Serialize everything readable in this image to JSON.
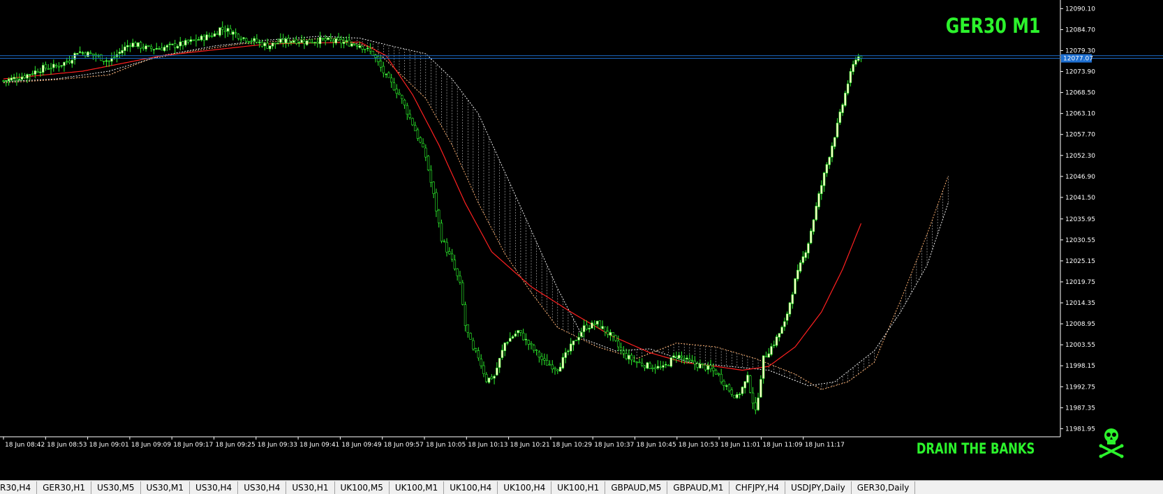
{
  "symbol_title": "GER30 M1",
  "brand_text": "DRAIN THE BANKS",
  "brand_icon": "skull-crossbones-icon",
  "colors": {
    "background": "#000000",
    "bull_candle": "#ffffc8",
    "bear_candle": "#000000",
    "wick": "#2cf32c",
    "moving_average": "#ff2020",
    "kumo_line_a": "#ffb070",
    "kumo_line_b": "#f0f0f0",
    "horizontal_line": "#1e6fd0",
    "price_box": "#1e6fd0",
    "title": "#2cf32c"
  },
  "price_box_value": "12077.07",
  "tabs": [
    "R30,H4",
    "GER30,H1",
    "US30,M5",
    "US30,M1",
    "US30,H4",
    "US30,H4",
    "US30,H1",
    "UK100,M5",
    "UK100,M1",
    "UK100,H4",
    "UK100,H4",
    "UK100,H1",
    "GBPAUD,M5",
    "GBPAUD,M1",
    "CHFJPY,H4",
    "USDJPY,Daily",
    "GER30,Daily"
  ],
  "chart_data": {
    "type": "candlestick",
    "title": "GER30 M1",
    "ylim": [
      11980.4,
      12091.6
    ],
    "y_ticks": [
      "12090.10",
      "12084.70",
      "12079.30",
      "12073.90",
      "12068.50",
      "12063.10",
      "12057.70",
      "12052.30",
      "12046.90",
      "12041.50",
      "12035.95",
      "12030.55",
      "12025.15",
      "12019.75",
      "12014.35",
      "12008.95",
      "12003.55",
      "11998.15",
      "11992.75",
      "11987.35",
      "11981.95"
    ],
    "x_ticks": [
      "18 Jun 08:42",
      "18 Jun 08:53",
      "18 Jun 09:01",
      "18 Jun 09:09",
      "18 Jun 09:17",
      "18 Jun 09:25",
      "18 Jun 09:33",
      "18 Jun 09:41",
      "18 Jun 09:49",
      "18 Jun 09:57",
      "18 Jun 10:05",
      "18 Jun 10:13",
      "18 Jun 10:21",
      "18 Jun 10:29",
      "18 Jun 10:37",
      "18 Jun 10:45",
      "18 Jun 10:53",
      "18 Jun 11:01",
      "18 Jun 11:09",
      "18 Jun 11:17"
    ],
    "horizontal_lines": [
      12078.0,
      12077.3
    ],
    "anchors": {
      "close": [
        [
          0,
          12071.5
        ],
        [
          8,
          12072.8
        ],
        [
          15,
          12074.8
        ],
        [
          20,
          12075.2
        ],
        [
          25,
          12076.8
        ],
        [
          28,
          12079.1
        ],
        [
          35,
          12078.0
        ],
        [
          40,
          12076.5
        ],
        [
          48,
          12081.2
        ],
        [
          55,
          12079.8
        ],
        [
          60,
          12080.0
        ],
        [
          68,
          12081.0
        ],
        [
          72,
          12081.8
        ],
        [
          80,
          12083.5
        ],
        [
          82,
          12085.0
        ],
        [
          86,
          12084.3
        ],
        [
          90,
          12082.8
        ],
        [
          95,
          12081.8
        ],
        [
          100,
          12080.5
        ],
        [
          105,
          12081.5
        ],
        [
          110,
          12082.0
        ],
        [
          115,
          12081.6
        ],
        [
          120,
          12082.0
        ],
        [
          125,
          12081.7
        ],
        [
          130,
          12081.3
        ],
        [
          135,
          12080.8
        ],
        [
          140,
          12078.5
        ],
        [
          145,
          12072.5
        ],
        [
          150,
          12068.0
        ],
        [
          155,
          12060.5
        ],
        [
          160,
          12052.0
        ],
        [
          163,
          12042.0
        ],
        [
          166,
          12031.0
        ],
        [
          170,
          12025.0
        ],
        [
          173,
          12019.0
        ],
        [
          175,
          12008.5
        ],
        [
          178,
          12002.0
        ],
        [
          180,
          12000.5
        ],
        [
          183,
          11994.5
        ],
        [
          186,
          11995.5
        ],
        [
          190,
          12004.0
        ],
        [
          195,
          12007.0
        ],
        [
          200,
          12003.0
        ],
        [
          205,
          11999.0
        ],
        [
          210,
          11997.5
        ],
        [
          215,
          12003.0
        ],
        [
          220,
          12008.0
        ],
        [
          225,
          12009.0
        ],
        [
          230,
          12006.0
        ],
        [
          235,
          12001.0
        ],
        [
          240,
          11999.0
        ],
        [
          245,
          11998.0
        ],
        [
          250,
          11997.5
        ],
        [
          255,
          12001.0
        ],
        [
          260,
          11999.0
        ],
        [
          265,
          11998.0
        ],
        [
          270,
          11996.5
        ],
        [
          275,
          11992.0
        ],
        [
          278,
          11990.0
        ],
        [
          282,
          11995.0
        ],
        [
          285,
          11986.0
        ],
        [
          288,
          12000.0
        ],
        [
          292,
          12004.0
        ],
        [
          296,
          12009.0
        ],
        [
          300,
          12020.0
        ],
        [
          305,
          12030.0
        ],
        [
          309,
          12042.0
        ],
        [
          312,
          12050.0
        ],
        [
          316,
          12060.0
        ],
        [
          320,
          12071.0
        ],
        [
          323,
          12077.5
        ],
        [
          325,
          12077.8
        ]
      ],
      "ma": [
        [
          0,
          12072.0
        ],
        [
          30,
          12074.0
        ],
        [
          60,
          12078.0
        ],
        [
          100,
          12081.0
        ],
        [
          135,
          12081.5
        ],
        [
          145,
          12078.0
        ],
        [
          155,
          12068.0
        ],
        [
          165,
          12055.0
        ],
        [
          175,
          12040.0
        ],
        [
          185,
          12027.5
        ],
        [
          200,
          12018.5
        ],
        [
          215,
          12012.0
        ],
        [
          230,
          12006.0
        ],
        [
          245,
          12001.5
        ],
        [
          258,
          11999.0
        ],
        [
          270,
          11998.0
        ],
        [
          280,
          11997.0
        ],
        [
          290,
          11998.0
        ],
        [
          300,
          12003.0
        ],
        [
          310,
          12012.0
        ],
        [
          318,
          12023.0
        ],
        [
          325,
          12034.8
        ]
      ],
      "span_a": [
        [
          0,
          12071.0
        ],
        [
          20,
          12071.8
        ],
        [
          40,
          12073.0
        ],
        [
          55,
          12077.0
        ],
        [
          70,
          12079.0
        ],
        [
          90,
          12081.0
        ],
        [
          110,
          12082.0
        ],
        [
          125,
          12082.5
        ],
        [
          140,
          12080.0
        ],
        [
          160,
          12067.0
        ],
        [
          170,
          12055.0
        ],
        [
          180,
          12040.0
        ],
        [
          190,
          12027.0
        ],
        [
          200,
          12017.0
        ],
        [
          210,
          12008.0
        ],
        [
          225,
          12003.0
        ],
        [
          240,
          12000.0
        ],
        [
          255,
          12004.0
        ],
        [
          270,
          12003.0
        ],
        [
          285,
          12000.0
        ],
        [
          300,
          11996.0
        ],
        [
          310,
          11992.0
        ],
        [
          320,
          11994.0
        ],
        [
          330,
          11999.0
        ],
        [
          340,
          12015.0
        ],
        [
          350,
          12032.0
        ],
        [
          358,
          12047.0
        ]
      ],
      "span_b": [
        [
          0,
          12071.3
        ],
        [
          20,
          12072.0
        ],
        [
          40,
          12074.0
        ],
        [
          60,
          12078.0
        ],
        [
          80,
          12080.5
        ],
        [
          100,
          12082.0
        ],
        [
          120,
          12083.0
        ],
        [
          135,
          12082.5
        ],
        [
          150,
          12080.0
        ],
        [
          160,
          12078.5
        ],
        [
          170,
          12072.0
        ],
        [
          180,
          12063.0
        ],
        [
          190,
          12048.0
        ],
        [
          200,
          12033.0
        ],
        [
          210,
          12018.0
        ],
        [
          220,
          12005.0
        ],
        [
          232,
          12002.0
        ],
        [
          245,
          12002.5
        ],
        [
          260,
          11999.0
        ],
        [
          275,
          11998.0
        ],
        [
          290,
          11997.0
        ],
        [
          305,
          11993.0
        ],
        [
          315,
          11994.0
        ],
        [
          330,
          12002.0
        ],
        [
          340,
          12012.0
        ],
        [
          350,
          12024.0
        ],
        [
          358,
          12040.0
        ]
      ]
    },
    "candle_count": 326
  }
}
